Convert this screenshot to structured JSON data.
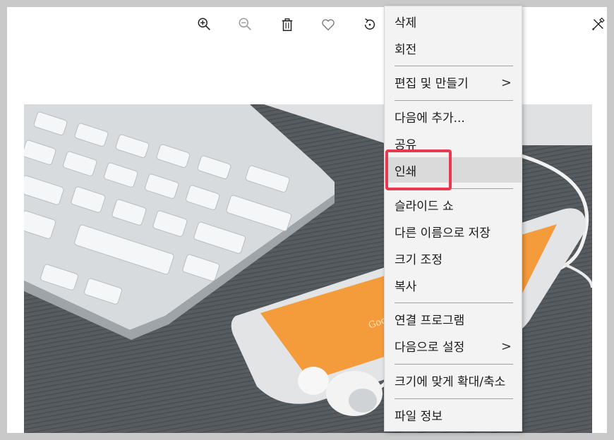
{
  "toolbar": {
    "buttons": [
      "zoom-in-icon",
      "zoom-out-icon",
      "delete-icon",
      "favorite-icon",
      "rotate-icon",
      "edit-tools-icon"
    ]
  },
  "photo": {
    "phone_text": "Google play"
  },
  "menu": {
    "items": [
      {
        "label": "삭제"
      },
      {
        "label": "회전"
      },
      {
        "label": "편집 및 만들기",
        "submenu": ">"
      },
      {
        "label": "다음에 추가..."
      },
      {
        "label": "공유"
      },
      {
        "label": "인쇄"
      },
      {
        "label": "슬라이드 쇼"
      },
      {
        "label": "다른 이름으로 저장"
      },
      {
        "label": "크기 조정"
      },
      {
        "label": "복사"
      },
      {
        "label": "연결 프로그램"
      },
      {
        "label": "다음으로 설정",
        "submenu": ">"
      },
      {
        "label": "크기에 맞게 확대/축소"
      },
      {
        "label": "파일 정보"
      }
    ],
    "highlighted_item": "인쇄",
    "highlight_color": "#e83a4e"
  }
}
